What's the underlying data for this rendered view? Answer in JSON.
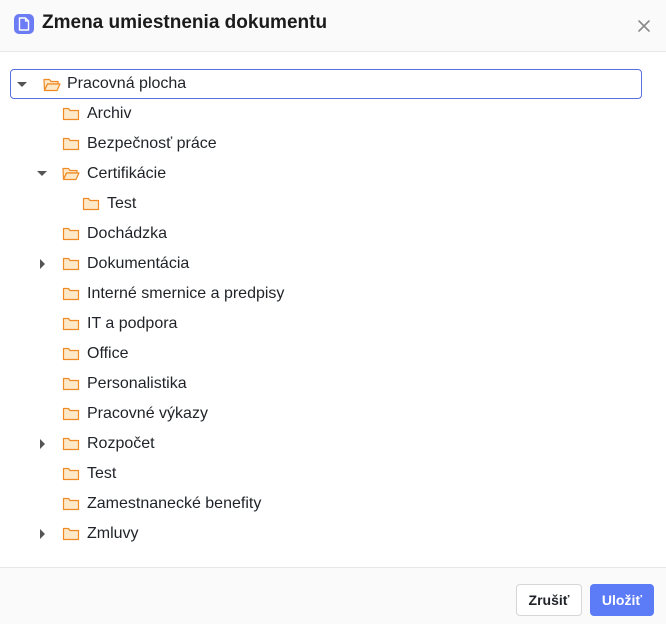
{
  "dialog": {
    "title": "Zmena umiestnenia dokumentu",
    "header_icon": "document-icon",
    "close_icon": "close-icon"
  },
  "tree": {
    "root": {
      "label": "Pracovná plocha",
      "expanded": true,
      "selected": true
    },
    "items": [
      {
        "label": "Archiv",
        "caret": "none"
      },
      {
        "label": "Bezpečnosť práce",
        "caret": "none"
      },
      {
        "label": "Certifikácie",
        "caret": "expanded"
      },
      {
        "label": "Test",
        "caret": "none"
      },
      {
        "label": "Dochádzka",
        "caret": "none"
      },
      {
        "label": "Dokumentácia",
        "caret": "collapsed"
      },
      {
        "label": "Interné smernice a predpisy",
        "caret": "none"
      },
      {
        "label": "IT a podpora",
        "caret": "none"
      },
      {
        "label": "Office",
        "caret": "none"
      },
      {
        "label": "Personalistika",
        "caret": "none"
      },
      {
        "label": "Pracovné výkazy",
        "caret": "none"
      },
      {
        "label": "Rozpočet",
        "caret": "collapsed"
      },
      {
        "label": "Test",
        "caret": "none"
      },
      {
        "label": "Zamestnanecké benefity",
        "caret": "none"
      },
      {
        "label": "Zmluvy",
        "caret": "collapsed"
      }
    ]
  },
  "footer": {
    "cancel_label": "Zrušiť",
    "save_label": "Uložiť"
  },
  "colors": {
    "accent": "#5b7bf7",
    "folder_fill": "#fde8c8",
    "folder_stroke": "#f08a24",
    "selection_border": "#5a6fe0"
  }
}
